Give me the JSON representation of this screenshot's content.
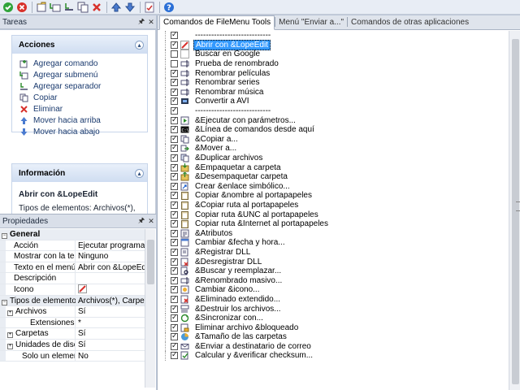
{
  "toolbar": {
    "buttons": [
      "ok-icon",
      "cancel-icon",
      "add-command-icon",
      "add-submenu-icon",
      "add-separator-icon",
      "copy-icon",
      "delete-icon",
      "move-up-icon",
      "move-down-icon",
      "apply-icon",
      "help-icon"
    ]
  },
  "tasks": {
    "title": "Tareas",
    "actions_title": "Acciones",
    "actions": [
      {
        "label": "Agregar comando",
        "icon": "add-command-icon"
      },
      {
        "label": "Agregar submenú",
        "icon": "add-submenu-icon"
      },
      {
        "label": "Agregar separador",
        "icon": "add-separator-icon"
      },
      {
        "label": "Copiar",
        "icon": "copy-icon"
      },
      {
        "label": "Eliminar",
        "icon": "delete-icon"
      },
      {
        "label": "Mover hacia arriba",
        "icon": "move-up-icon"
      },
      {
        "label": "Mover hacia abajo",
        "icon": "move-down-icon"
      }
    ],
    "info_title": "Información",
    "info_name": "Abrir con &LopeEdit",
    "info_desc": "Tipos de elementos: Archivos(*), Carpetas, Unidades"
  },
  "properties": {
    "title": "Propiedades",
    "rows": [
      {
        "type": "cat",
        "key": "General",
        "value": ""
      },
      {
        "type": "prop",
        "key": "Acción",
        "value": "Ejecutar programa"
      },
      {
        "type": "prop",
        "key": "Mostrar con la tecla",
        "value": "Ninguno"
      },
      {
        "type": "prop",
        "key": "Texto en el menú",
        "value": "Abrir con &LopeEdit"
      },
      {
        "type": "prop",
        "key": "Descripción",
        "value": ""
      },
      {
        "type": "prop",
        "key": "Icono",
        "value": ""
      },
      {
        "type": "cat",
        "key": "Tipos de elementos",
        "value": "Archivos(*), Carpetas,"
      },
      {
        "type": "sub",
        "key": "Archivos",
        "value": "Sí"
      },
      {
        "type": "sub2",
        "key": "Extensiones",
        "value": "*"
      },
      {
        "type": "sub",
        "key": "Carpetas",
        "value": "Sí"
      },
      {
        "type": "sub",
        "key": "Unidades de disc",
        "value": "Sí"
      },
      {
        "type": "sub3",
        "key": "Solo un elemento",
        "value": "No"
      }
    ]
  },
  "tabs": [
    {
      "label": "Comandos de FileMenu Tools",
      "active": true
    },
    {
      "label": "Menú \"Enviar a...\"",
      "active": false
    },
    {
      "label": "Comandos de otras aplicaciones",
      "active": false
    }
  ],
  "commands": [
    {
      "label": "----------------------------",
      "checked": true,
      "icon": ""
    },
    {
      "label": "Abrir con &LopeEdit",
      "checked": true,
      "icon": "lopeedit-icon",
      "selected": true
    },
    {
      "label": "Buscar en Google",
      "checked": false,
      "icon": "google-icon"
    },
    {
      "label": "Prueba de renombrado",
      "checked": false,
      "icon": "rename-icon"
    },
    {
      "label": "Renombrar películas",
      "checked": true,
      "icon": "rename-icon"
    },
    {
      "label": "Renombrar series",
      "checked": true,
      "icon": "rename-icon"
    },
    {
      "label": "Renombrar música",
      "checked": true,
      "icon": "rename-icon"
    },
    {
      "label": "Convertir a AVI",
      "checked": true,
      "icon": "video-icon"
    },
    {
      "label": "----------------------------",
      "checked": true,
      "icon": ""
    },
    {
      "label": "&Ejecutar con parámetros...",
      "checked": true,
      "icon": "run-icon"
    },
    {
      "label": "&Línea de comandos desde aquí",
      "checked": true,
      "icon": "console-icon"
    },
    {
      "label": "&Copiar a...",
      "checked": true,
      "icon": "copy-icon"
    },
    {
      "label": "&Mover a...",
      "checked": true,
      "icon": "move-icon"
    },
    {
      "label": "&Duplicar archivos",
      "checked": true,
      "icon": "duplicate-icon"
    },
    {
      "label": "&Empaquetar a carpeta",
      "checked": true,
      "icon": "pack-icon"
    },
    {
      "label": "&Desempaquetar carpeta",
      "checked": true,
      "icon": "unpack-icon"
    },
    {
      "label": "Crear &enlace simbólico...",
      "checked": true,
      "icon": "link-icon"
    },
    {
      "label": "Copiar &nombre al portapapeles",
      "checked": true,
      "icon": "clipboard-icon"
    },
    {
      "label": "&Copiar ruta al portapapeles",
      "checked": true,
      "icon": "clipboard-icon"
    },
    {
      "label": "Copiar ruta &UNC al portapapeles",
      "checked": true,
      "icon": "clipboard-icon"
    },
    {
      "label": "Copiar ruta &Internet al portapapeles",
      "checked": true,
      "icon": "clipboard-icon"
    },
    {
      "label": "&Atributos",
      "checked": true,
      "icon": "attributes-icon"
    },
    {
      "label": "Cambiar &fecha y hora...",
      "checked": true,
      "icon": "date-icon"
    },
    {
      "label": "&Registrar DLL",
      "checked": true,
      "icon": "dll-icon"
    },
    {
      "label": "&Desregistrar DLL",
      "checked": true,
      "icon": "dll-remove-icon"
    },
    {
      "label": "&Buscar y reemplazar...",
      "checked": true,
      "icon": "find-icon"
    },
    {
      "label": "&Renombrado masivo...",
      "checked": true,
      "icon": "rename-icon"
    },
    {
      "label": "Cambiar &icono...",
      "checked": true,
      "icon": "change-icon-icon"
    },
    {
      "label": "&Eliminado extendido...",
      "checked": true,
      "icon": "delete-ext-icon"
    },
    {
      "label": "&Destruir los archivos...",
      "checked": true,
      "icon": "shred-icon"
    },
    {
      "label": "&Sincronizar con...",
      "checked": true,
      "icon": "sync-icon"
    },
    {
      "label": "Eliminar archivo &bloqueado",
      "checked": true,
      "icon": "locked-delete-icon"
    },
    {
      "label": "&Tamaño de las carpetas",
      "checked": true,
      "icon": "folder-size-icon"
    },
    {
      "label": "&Enviar a destinatario de correo",
      "checked": true,
      "icon": "mail-icon"
    },
    {
      "label": "Calcular y &verificar checksum...",
      "checked": true,
      "icon": "checksum-icon"
    }
  ],
  "colors": {
    "selection": "#3399ff",
    "panel_header": "#d9dfe9"
  }
}
